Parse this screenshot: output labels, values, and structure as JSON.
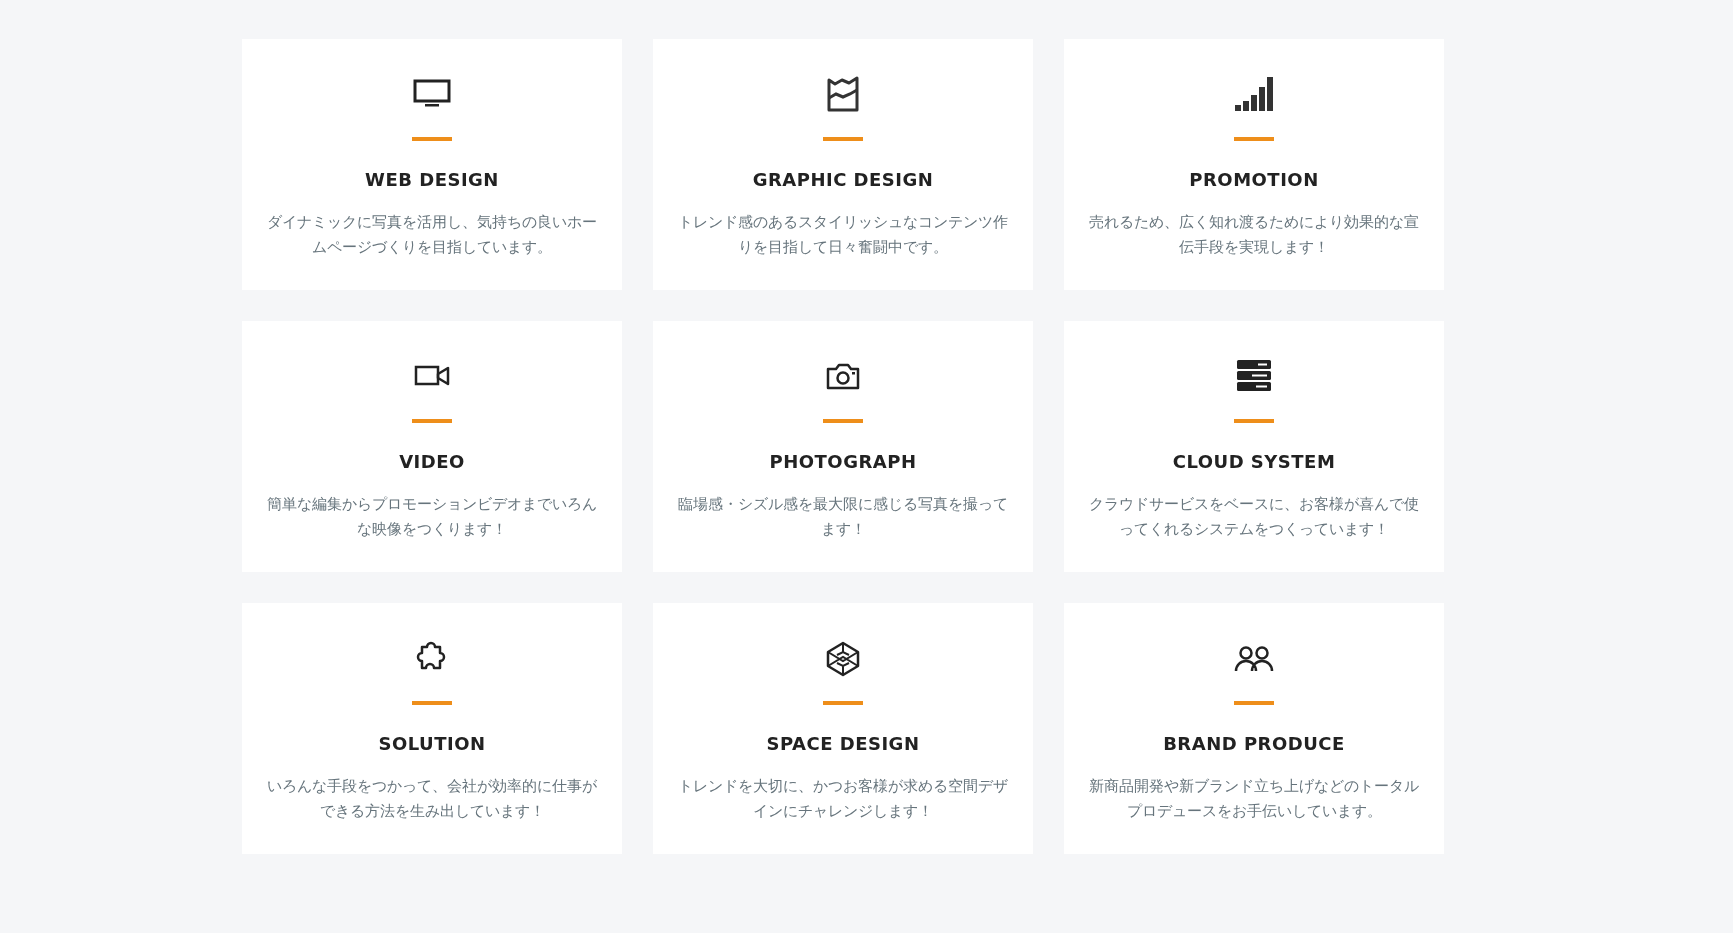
{
  "services": [
    {
      "title": "WEB DESIGN",
      "description": "ダイナミックに写真を活用し、気持ちの良いホームページづくりを目指しています。"
    },
    {
      "title": "GRAPHIC DESIGN",
      "description": "トレンド感のあるスタイリッシュなコンテンツ作りを目指して日々奮闘中です。"
    },
    {
      "title": "PROMOTION",
      "description": "売れるため、広く知れ渡るためにより効果的な宣伝手段を実現します！"
    },
    {
      "title": "VIDEO",
      "description": "簡単な編集からプロモーションビデオまでいろんな映像をつくります！"
    },
    {
      "title": "PHOTOGRAPH",
      "description": "臨場感・シズル感を最大限に感じる写真を撮ってます！"
    },
    {
      "title": "CLOUD SYSTEM",
      "description": "クラウドサービスをベースに、お客様が喜んで使ってくれるシステムをつくっています！"
    },
    {
      "title": "SOLUTION",
      "description": "いろんな手段をつかって、会社が効率的に仕事ができる方法を生み出しています！"
    },
    {
      "title": "SPACE DESIGN",
      "description": "トレンドを大切に、かつお客様が求める空間デザインにチャレンジします！"
    },
    {
      "title": "BRAND PRODUCE",
      "description": "新商品開発や新ブランド立ち上げなどのトータルプロデュースをお手伝いしています。"
    }
  ]
}
